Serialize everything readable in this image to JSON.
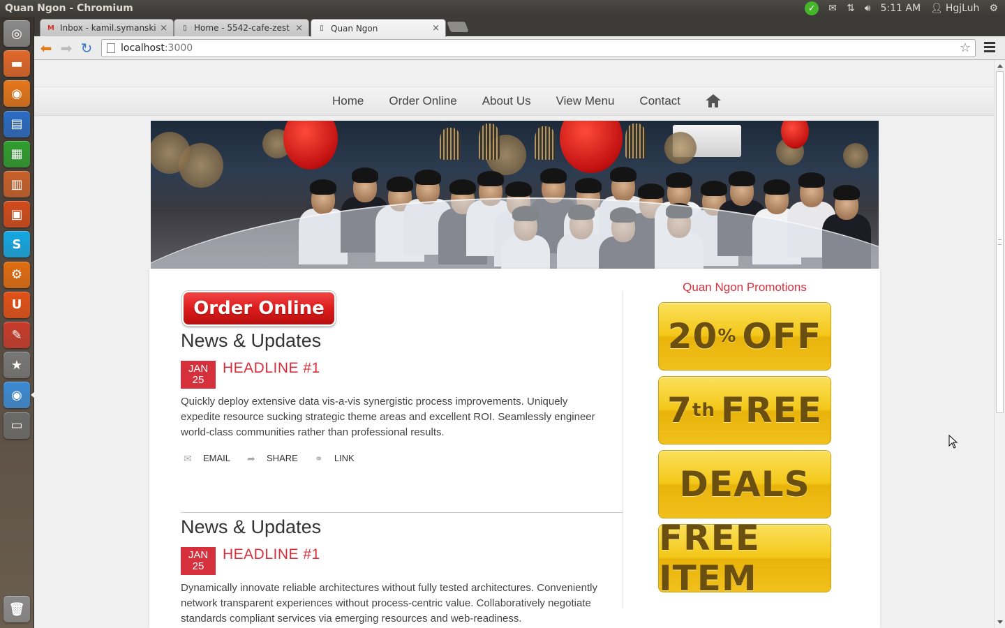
{
  "top_panel": {
    "window_title": "Quan Ngon - Chromium",
    "time": "5:11 AM",
    "user": "HgjLuh"
  },
  "launcher": {
    "items": [
      {
        "name": "dash-home-icon",
        "color": "#8a8a8a"
      },
      {
        "name": "files-icon",
        "color": "#e2682a"
      },
      {
        "name": "firefox-icon",
        "color": "#e6761a"
      },
      {
        "name": "writer-icon",
        "color": "#2a6cc4"
      },
      {
        "name": "calc-icon",
        "color": "#2e9e2e"
      },
      {
        "name": "impress-icon",
        "color": "#c8602a"
      },
      {
        "name": "software-center-icon",
        "color": "#d24a1a"
      },
      {
        "name": "skype-icon",
        "color": "#14a8e4"
      },
      {
        "name": "settings-icon",
        "color": "#e26c10"
      },
      {
        "name": "ubuntu-one-icon",
        "color": "#e25016"
      },
      {
        "name": "tools-icon",
        "color": "#c83a2a"
      },
      {
        "name": "starred-icon",
        "color": "#777777"
      },
      {
        "name": "chromium-icon",
        "color": "#3a8ad4"
      },
      {
        "name": "workspaces-icon",
        "color": "#6a6a6a"
      },
      {
        "name": "trash-icon",
        "color": "#8a8a8a"
      }
    ]
  },
  "browser": {
    "tabs": [
      {
        "label": "Inbox - kamil.symanski@gr"
      },
      {
        "label": "Home - 5542-cafe-zest"
      },
      {
        "label": "Quan Ngon"
      }
    ],
    "url_host": "localhost",
    "url_port": ":3000"
  },
  "site": {
    "nav": [
      "Home",
      "Order Online",
      "About Us",
      "View Menu",
      "Contact"
    ],
    "order_button": "Order Online",
    "news": [
      {
        "heading": "News & Updates",
        "month": "JAN",
        "day": "25",
        "headline": "HEADLINE #1",
        "body": "Quickly deploy extensive data vis-a-vis synergistic process improvements. Uniquely expedite resource sucking strategic theme areas and excellent ROI. Seamlessly engineer world-class communities rather than professional results.",
        "actions": {
          "email": "EMAIL",
          "share": "SHARE",
          "link": "LINK"
        }
      },
      {
        "heading": "News & Updates",
        "month": "JAN",
        "day": "25",
        "headline": "HEADLINE #1",
        "body": "Dynamically innovate reliable architectures without fully tested architectures. Conveniently network transparent experiences without process-centric value. Collaboratively negotiate standards compliant services via emerging resources and web-readiness."
      }
    ],
    "promotions": {
      "title": "Quan Ngon Promotions",
      "items": [
        {
          "main": "20",
          "sup": "%",
          "rest": "OFF"
        },
        {
          "main": "7",
          "sup": "th",
          "rest": "FREE"
        },
        {
          "main": "DEALS",
          "sup": "",
          "rest": ""
        },
        {
          "main": "FREE ITEM",
          "sup": "",
          "rest": ""
        }
      ]
    },
    "colors": {
      "accent": "#d6303c",
      "promo_gold": "#f4c81a"
    }
  }
}
